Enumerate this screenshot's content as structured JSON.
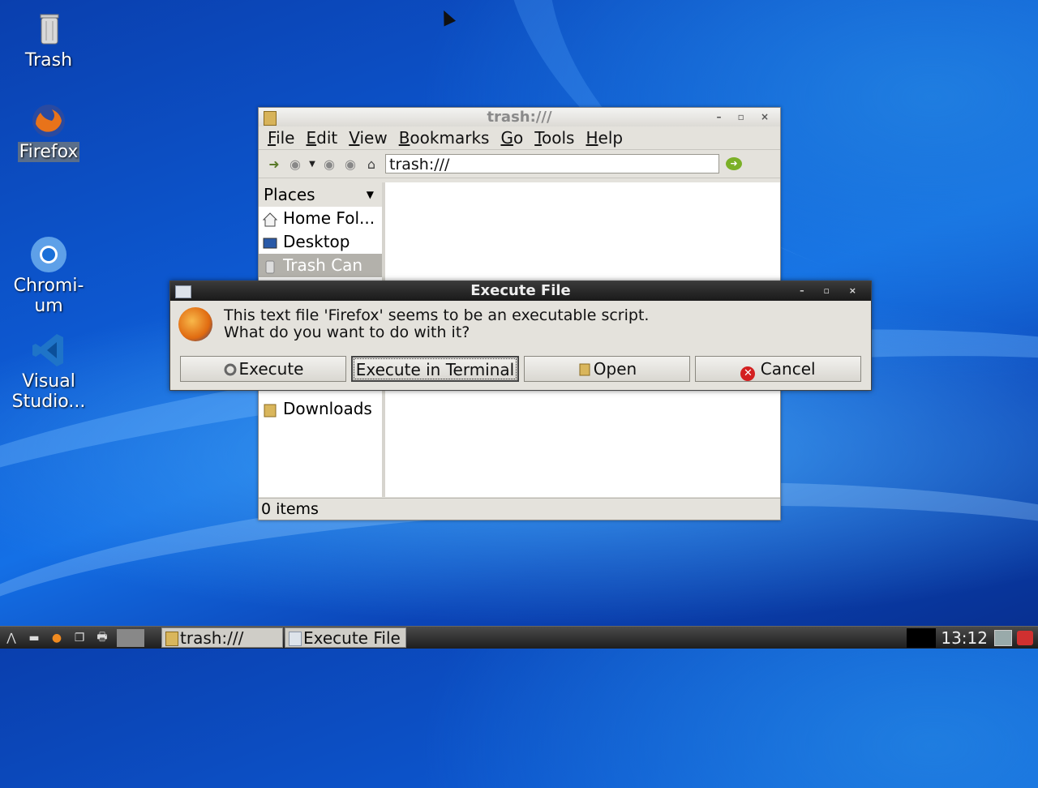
{
  "desktop": {
    "icons": [
      {
        "label": "Trash"
      },
      {
        "label": "Firefox"
      },
      {
        "label": "Chromi-\num"
      },
      {
        "label": "Visual\nStudio..."
      }
    ]
  },
  "file_manager": {
    "title": "trash:///",
    "menu": [
      "File",
      "Edit",
      "View",
      "Bookmarks",
      "Go",
      "Tools",
      "Help"
    ],
    "address": "trash:///",
    "sidebar_header": "Places",
    "sidebar_items": [
      "Home Fol...",
      "Desktop",
      "Trash Can",
      "Downloads"
    ],
    "status": "0 items"
  },
  "dialog": {
    "title": "Execute File",
    "message_line1": "This text file 'Firefox' seems to be an executable script.",
    "message_line2": "What do you want to do with it?",
    "buttons": [
      "Execute",
      "Execute in Terminal",
      "Open",
      "Cancel"
    ]
  },
  "taskbar": {
    "tasks": [
      "trash:///",
      "Execute File"
    ],
    "clock": "13:12"
  }
}
